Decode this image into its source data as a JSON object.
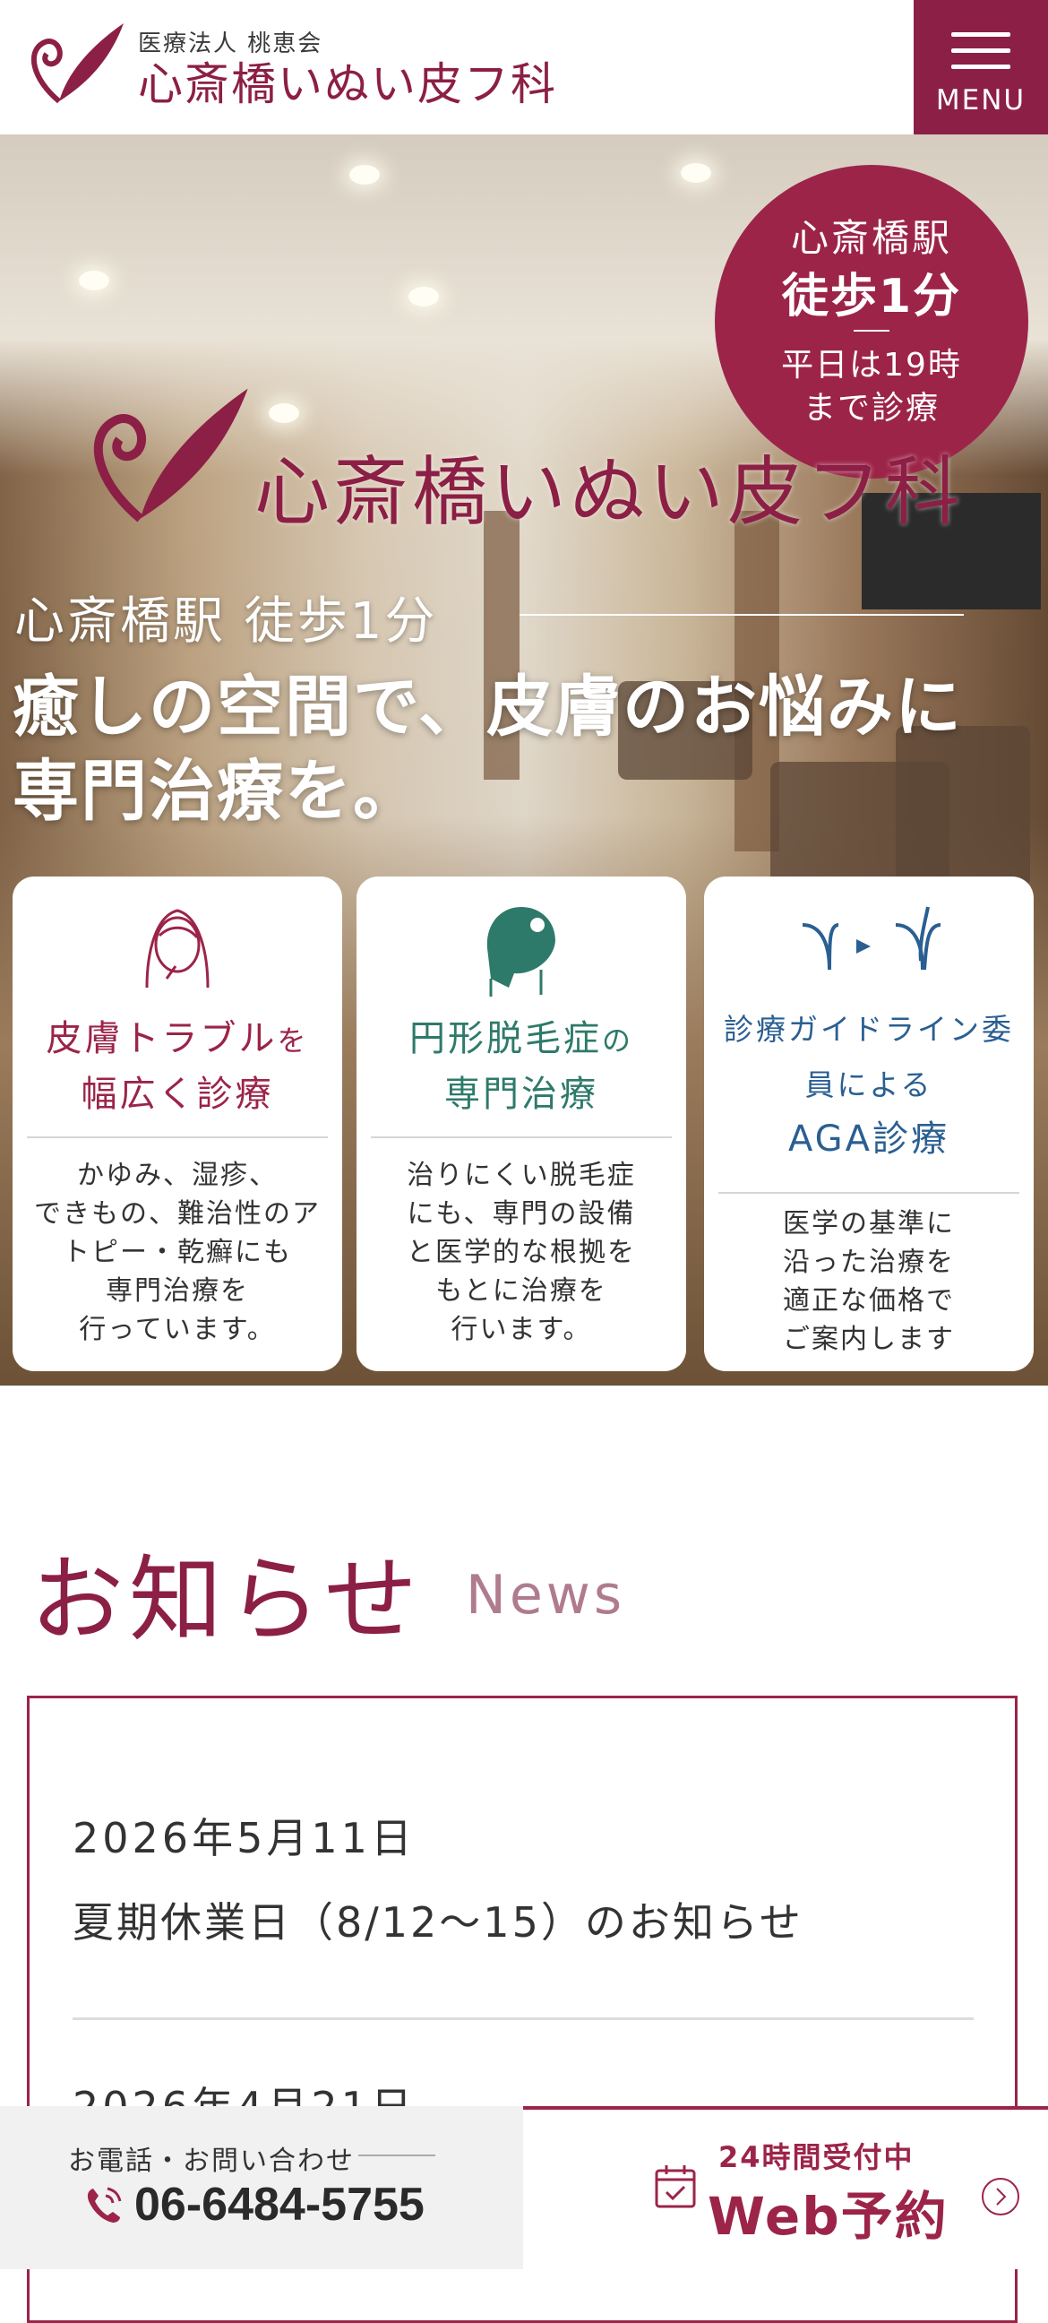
{
  "header": {
    "logo_sub": "医療法人 桃恵会",
    "logo_name": "心斎橋いぬい皮フ科",
    "menu_label": "MENU"
  },
  "hero": {
    "badge": {
      "line1": "心斎橋駅",
      "line2": "徒歩1分",
      "line3": "平日は19時",
      "line4": "まで診療"
    },
    "logo_name": "心斎橋いぬい皮フ科",
    "sub": "心斎橋駅 徒歩1分",
    "catch_line1": "癒しの空間で、皮膚のお悩みに",
    "catch_line2": "専門治療を。"
  },
  "cards": [
    {
      "title_line1": "皮膚トラブル",
      "title_suffix": "を",
      "title_line2": "幅広く診療",
      "text": "かゆみ、湿疹、\nできもの、難治性のア\nトピー・乾癬にも\n専門治療を\n行っています。",
      "color": "#9c2449"
    },
    {
      "title_line1": "円形脱毛症",
      "title_suffix": "の",
      "title_line2": "専門治療",
      "text": "治りにくい脱毛症\nにも、専門の設備\nと医学的な根拠を\nもとに治療を\n行います。",
      "color": "#2e7a6a"
    },
    {
      "title_line1": "診療ガイドライン委",
      "title_line2": "員による",
      "title_line3": "AGA診療",
      "text": "医学の基準に\n沿った治療を\n適正な価格で\nご案内します",
      "color": "#2a5f92"
    }
  ],
  "news": {
    "title": "お知らせ",
    "sub": "News",
    "items": [
      {
        "date": "2026年5月11日",
        "text": "夏期休業日（8/12～15）のお知らせ"
      },
      {
        "date": "2026年4月21日",
        "text": ""
      }
    ]
  },
  "bottom": {
    "tel_label": "お電話・お問い合わせ",
    "tel_number": "06-6484-5755",
    "web_top": "24時間受付中",
    "web_main": "Web予約"
  },
  "colors": {
    "brand": "#8c1f45",
    "teal": "#2e7a6a",
    "blue": "#2a5f92"
  }
}
